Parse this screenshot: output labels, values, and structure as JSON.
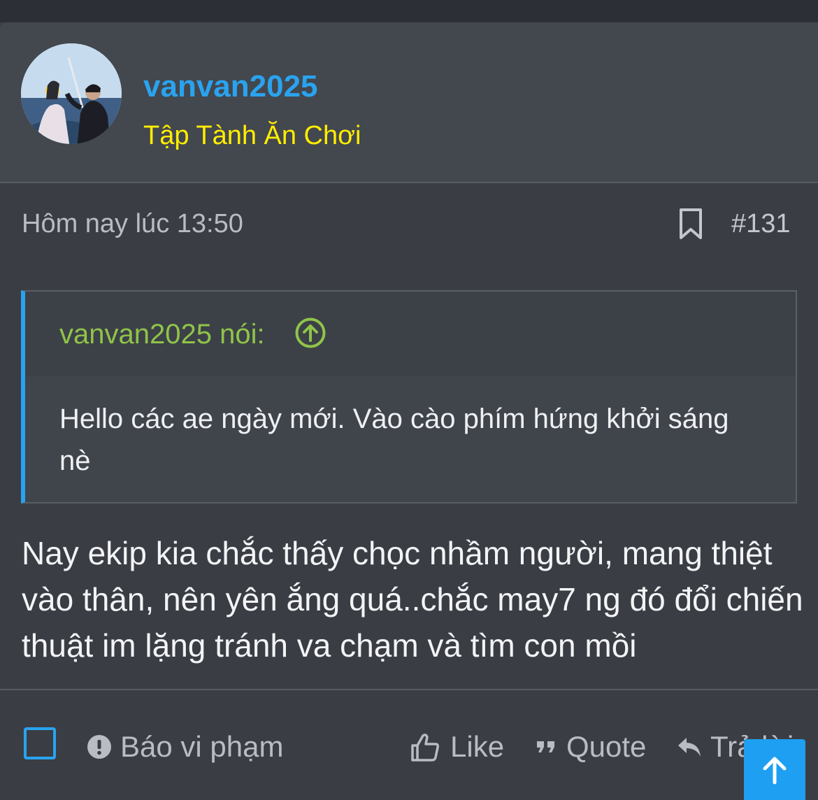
{
  "post": {
    "author": "vanvan2025",
    "user_title": "Tập Tành Ăn Chơi",
    "timestamp": "Hôm nay lúc 13:50",
    "post_number": "#131",
    "quote": {
      "author_line": "vanvan2025 nói:",
      "text": "Hello các ae ngày mới. Vào cào phím hứng khởi sáng nè"
    },
    "body": "Nay ekip kia chắc thấy chọc nhầm người, mang thiệt vào thân, nên yên ắng quá..chắc may7 ng đó đổi chiến thuật im lặng tránh va chạm và tìm con mồi"
  },
  "actions": {
    "report_label": "Báo vi phạm",
    "like_label": "Like",
    "quote_label": "Quote",
    "reply_label": "Trả lời"
  },
  "icons": {
    "bookmark": "bookmark-icon",
    "quote_jump": "arrow-circle-up-icon",
    "report": "exclamation-circle-icon",
    "like": "thumbs-up-icon",
    "quote": "quote-marks-icon",
    "reply": "reply-arrow-icon",
    "scroll_top": "arrow-up-icon"
  },
  "colors": {
    "background": "#3a3d44",
    "username": "#2aa3ef",
    "user_title": "#ffee00",
    "quote_author": "#8fc449",
    "accent": "#1e9ff1"
  }
}
